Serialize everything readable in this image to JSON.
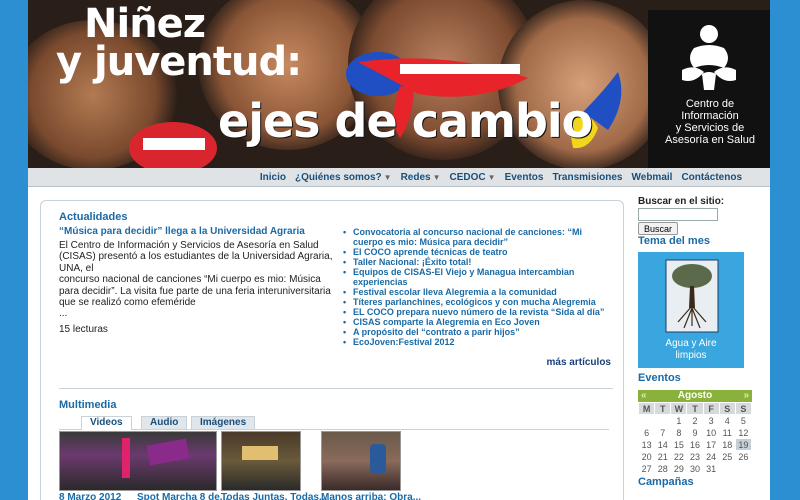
{
  "banner": {
    "title_line1": "Niñez",
    "title_line2": "y juventud:",
    "title_line3": "ejes de cambio",
    "org_lines": [
      "Centro de",
      "Información",
      "y Servicios de",
      "Asesoría en Salud"
    ],
    "colors": {
      "tongue": "#e8232a",
      "lips": "#d9262e",
      "teeth": "#ffffff",
      "accent_yellow": "#f2d61b",
      "accent_blue": "#1f4fc2"
    }
  },
  "nav": {
    "items": [
      {
        "label": "Inicio",
        "dropdown": false
      },
      {
        "label": "¿Quiénes somos?",
        "dropdown": true
      },
      {
        "label": "Redes",
        "dropdown": true
      },
      {
        "label": "CEDOC",
        "dropdown": true
      },
      {
        "label": "Eventos",
        "dropdown": false
      },
      {
        "label": "Transmisiones",
        "dropdown": false
      },
      {
        "label": "Webmail",
        "dropdown": false
      },
      {
        "label": "Contáctenos",
        "dropdown": false
      }
    ],
    "caret_icon": "▼"
  },
  "actualidades": {
    "title": "Actualidades",
    "lead_title": "“Música para decidir” llega a la Universidad Agraria",
    "lead_body_1": "El Centro de Información y Servicios de Asesoría en Salud (CISAS) presentó a los estudiantes de la Universidad Agraria, UNA, el",
    "lead_body_2": "concurso nacional de canciones “Mi cuerpo es mio: Música para decidir”. La visita fue parte de una feria interuniversitaria que se realizó como efeméride",
    "lead_ellipsis": "...",
    "lead_reads": "15 lecturas",
    "items": [
      "Convocatoria al concurso nacional de canciones: “Mi cuerpo es mio: Música para decidir”",
      "El COCO aprende técnicas de teatro",
      "Taller Nacional: ¡Éxito total!",
      "Equipos de CISAS-El Viejo y Managua intercambian experiencias",
      "Festival escolar lleva Alegremia a la comunidad",
      "Títeres parlanchines, ecológicos y con mucha Alegremia",
      "EL COCO prepara nuevo número de la revista “Sida al día”",
      "CISAS comparte la Alegremia en Eco Joven",
      "A propósito del “contrato a parir hijos”",
      "EcoJoven:Festival 2012"
    ],
    "more": "más artículos"
  },
  "multimedia": {
    "title": "Multimedia",
    "tabs": [
      "Videos",
      "Audio",
      "Imágenes"
    ],
    "active_tab": 0,
    "thumbs": [
      {
        "caption": "8 Marzo 2012"
      },
      {
        "caption": "Spot Marcha 8 de..."
      },
      {
        "caption": "Todas Juntas, Todas..."
      },
      {
        "caption": "Manos arriba: Obra..."
      }
    ]
  },
  "sidebar": {
    "search_label": "Buscar en el sitio:",
    "search_value": "",
    "search_button": "Buscar",
    "tema_title": "Tema del mes",
    "tema_caption_1": "Agua y Aire",
    "tema_caption_2": "limpios",
    "eventos_title": "Eventos",
    "calendar": {
      "month": "Agosto",
      "prev": "«",
      "next": "»",
      "weekdays": [
        "M",
        "T",
        "W",
        "T",
        "F",
        "S",
        "S"
      ],
      "weeks": [
        [
          "",
          "",
          "1",
          "2",
          "3",
          "4",
          "5"
        ],
        [
          "6",
          "7",
          "8",
          "9",
          "10",
          "11",
          "12"
        ],
        [
          "13",
          "14",
          "15",
          "16",
          "17",
          "18",
          "19"
        ],
        [
          "20",
          "21",
          "22",
          "23",
          "24",
          "25",
          "26"
        ],
        [
          "27",
          "28",
          "29",
          "30",
          "31",
          "",
          ""
        ]
      ],
      "today": "19"
    },
    "campanas_title": "Campañas"
  }
}
